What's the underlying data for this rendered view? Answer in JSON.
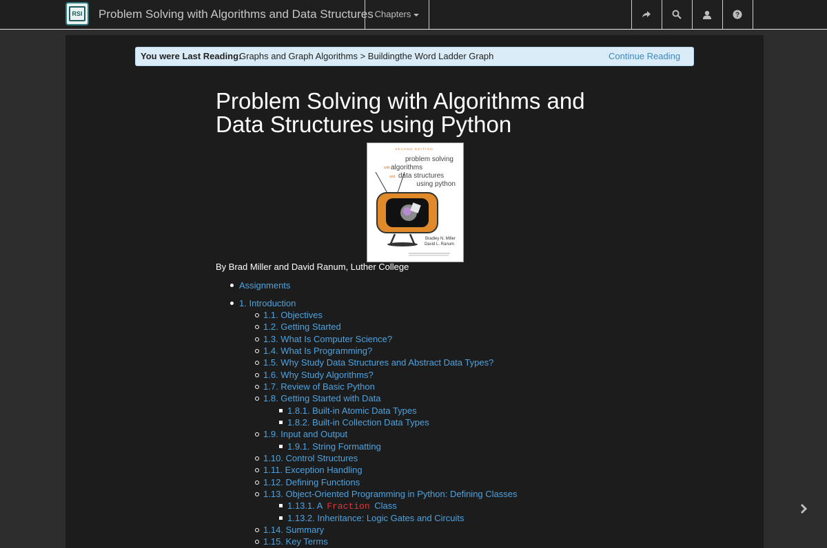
{
  "navbar": {
    "logo_text": "RSI",
    "brand": "Problem Solving with Algorithms and Data Structures",
    "chapters_label": "Chapters",
    "icons": [
      "share-icon",
      "search-icon",
      "user-icon",
      "help-icon"
    ]
  },
  "reading_banner": {
    "label": "You were Last Reading:",
    "path": "Graphs and Graph Algorithms > Buildingthe Word Ladder Graph",
    "continue": "Continue Reading"
  },
  "title": "Problem Solving with Algorithms and Data Structures using Python",
  "cover": {
    "edition": "SECOND EDITION",
    "line1": "problem solving",
    "line2": "algorithms",
    "line3": "data structures",
    "line4": "using python",
    "with": "with",
    "and": "and",
    "authors1": "Bradley N. Miller",
    "authors2": "David L. Ranum"
  },
  "byline": "By Brad Miller and David Ranum, Luther College",
  "toc": {
    "assignments": "Assignments",
    "intro": "1. Introduction",
    "items": [
      "1.1. Objectives",
      "1.2. Getting Started",
      "1.3. What Is Computer Science?",
      "1.4. What Is Programming?",
      "1.5. Why Study Data Structures and Abstract Data Types?",
      "1.6. Why Study Algorithms?",
      "1.7. Review of Basic Python",
      "1.8. Getting Started with Data",
      "1.8.1. Built-in Atomic Data Types",
      "1.8.2. Built-in Collection Data Types",
      "1.9. Input and Output",
      "1.9.1. String Formatting",
      "1.10. Control Structures",
      "1.11. Exception Handling",
      "1.12. Defining Functions",
      "1.13. Object-Oriented Programming in Python: Defining Classes",
      "1.13.1. A",
      "1.13.2. Inheritance: Logic Gates and Circuits",
      "1.14. Summary",
      "1.15. Key Terms"
    ],
    "fraction_code": "Fraction",
    "class_word": "Class"
  },
  "colors": {
    "link": "#4da3e0",
    "code": "#e2353c",
    "banner": "#d9ecf7"
  }
}
